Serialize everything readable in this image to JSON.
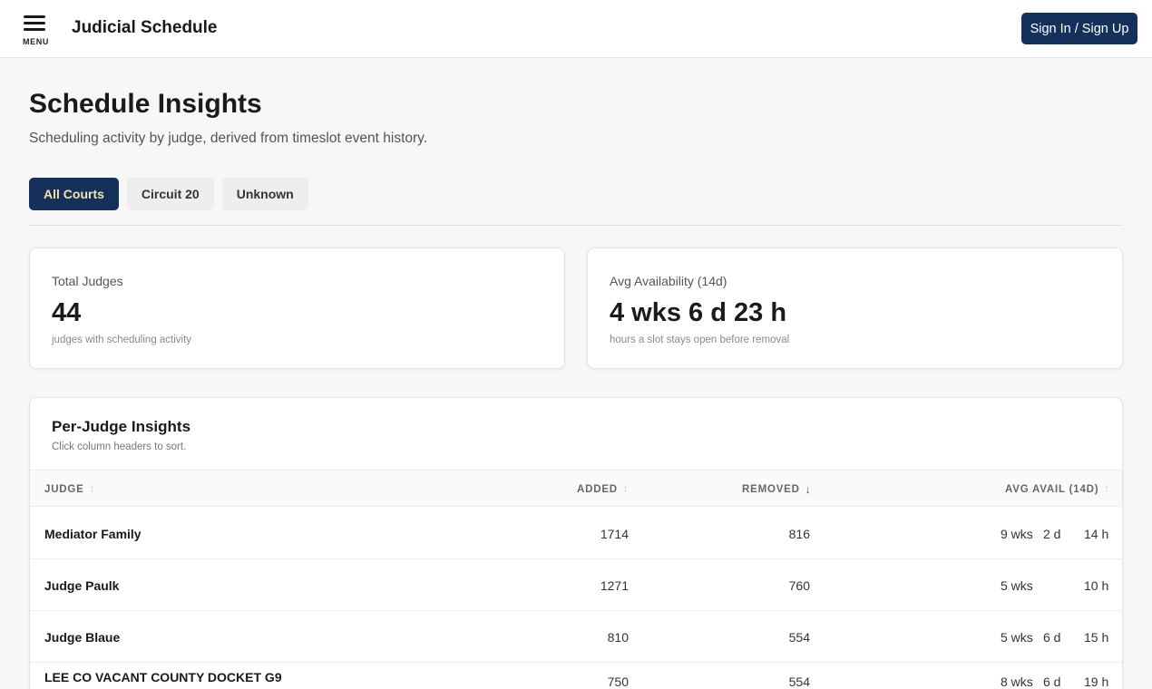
{
  "header": {
    "menu_label": "MENU",
    "app_title": "Judicial Schedule",
    "signin_label": "Sign In / Sign Up"
  },
  "page": {
    "title": "Schedule Insights",
    "subtitle": "Scheduling activity by judge, derived from timeslot event history."
  },
  "tabs": [
    {
      "label": "All Courts",
      "active": true
    },
    {
      "label": "Circuit 20",
      "active": false
    },
    {
      "label": "Unknown",
      "active": false
    }
  ],
  "stats": {
    "total_judges": {
      "label": "Total Judges",
      "value": "44",
      "note": "judges with scheduling activity"
    },
    "avg_availability": {
      "label": "Avg Availability (14d)",
      "value": "4 wks 6 d 23 h",
      "note": "hours a slot stays open before removal"
    }
  },
  "table": {
    "title": "Per-Judge Insights",
    "subtitle": "Click column headers to sort.",
    "columns": {
      "judge": "JUDGE",
      "added": "ADDED",
      "removed": "REMOVED",
      "avg_avail": "AVG AVAIL (14D)"
    },
    "sort_indicator": "↕",
    "sort_active_indicator": "↓",
    "rows": [
      {
        "judge": "Mediator Family",
        "added": "1714",
        "removed": "816",
        "wks": "9 wks",
        "days": "2 d",
        "hours": "14 h"
      },
      {
        "judge": "Judge Paulk",
        "added": "1271",
        "removed": "760",
        "wks": "5 wks",
        "days": "",
        "hours": "10 h"
      },
      {
        "judge": "Judge Blaue",
        "added": "810",
        "removed": "554",
        "wks": "5 wks",
        "days": "6 d",
        "hours": "15 h"
      },
      {
        "judge": "LEE CO VACANT COUNTY DOCKET G9",
        "added": "750",
        "removed": "554",
        "wks": "8 wks",
        "days": "6 d",
        "hours": "19 h"
      }
    ]
  }
}
